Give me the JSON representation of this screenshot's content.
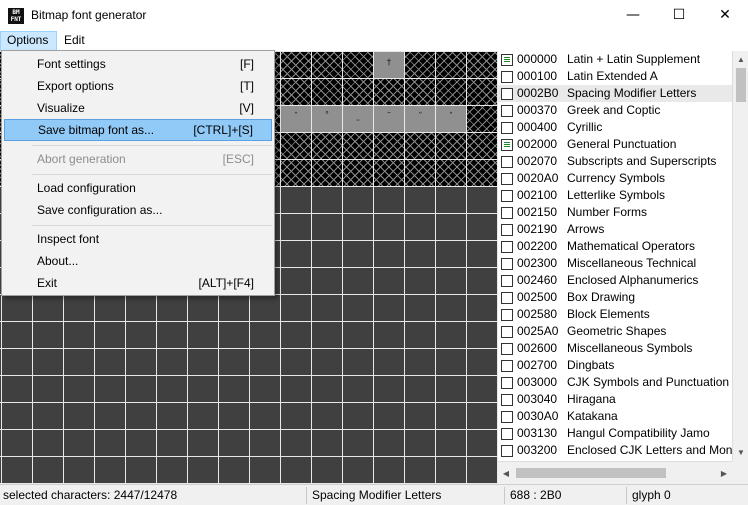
{
  "window": {
    "title": "Bitmap font generator",
    "icon_text": "BM FNT",
    "minimize_glyph": "—",
    "maximize_glyph": "☐",
    "close_glyph": "✕"
  },
  "menubar": {
    "options_label": "Options",
    "edit_label": "Edit"
  },
  "options_menu": {
    "items": [
      {
        "label": "Font settings",
        "shortcut": "[F]"
      },
      {
        "label": "Export options",
        "shortcut": "[T]"
      },
      {
        "label": "Visualize",
        "shortcut": "[V]"
      },
      {
        "label": "Save bitmap font as...",
        "shortcut": "[CTRL]+[S]"
      },
      {
        "label": "Abort generation",
        "shortcut": "[ESC]"
      },
      {
        "label": "Load configuration",
        "shortcut": ""
      },
      {
        "label": "Save configuration as...",
        "shortcut": ""
      },
      {
        "label": "Inspect font",
        "shortcut": ""
      },
      {
        "label": "About...",
        "shortcut": ""
      },
      {
        "label": "Exit",
        "shortcut": "[ALT]+[F4]"
      }
    ]
  },
  "glyphs": [
    "†",
    "ˆ",
    "˚",
    "˷",
    "˜",
    "˝",
    "˟"
  ],
  "charsets": [
    {
      "code": "000000",
      "name": "Latin + Latin Supplement",
      "state": "partial"
    },
    {
      "code": "000100",
      "name": "Latin Extended A",
      "state": "unchecked"
    },
    {
      "code": "0002B0",
      "name": "Spacing Modifier Letters",
      "state": "unchecked"
    },
    {
      "code": "000370",
      "name": "Greek and Coptic",
      "state": "unchecked"
    },
    {
      "code": "000400",
      "name": "Cyrillic",
      "state": "unchecked"
    },
    {
      "code": "002000",
      "name": "General Punctuation",
      "state": "partial"
    },
    {
      "code": "002070",
      "name": "Subscripts and Superscripts",
      "state": "unchecked"
    },
    {
      "code": "0020A0",
      "name": "Currency Symbols",
      "state": "unchecked"
    },
    {
      "code": "002100",
      "name": "Letterlike Symbols",
      "state": "unchecked"
    },
    {
      "code": "002150",
      "name": "Number Forms",
      "state": "unchecked"
    },
    {
      "code": "002190",
      "name": "Arrows",
      "state": "unchecked"
    },
    {
      "code": "002200",
      "name": "Mathematical Operators",
      "state": "unchecked"
    },
    {
      "code": "002300",
      "name": "Miscellaneous Technical",
      "state": "unchecked"
    },
    {
      "code": "002460",
      "name": "Enclosed Alphanumerics",
      "state": "unchecked"
    },
    {
      "code": "002500",
      "name": "Box Drawing",
      "state": "unchecked"
    },
    {
      "code": "002580",
      "name": "Block Elements",
      "state": "unchecked"
    },
    {
      "code": "0025A0",
      "name": "Geometric Shapes",
      "state": "unchecked"
    },
    {
      "code": "002600",
      "name": "Miscellaneous Symbols",
      "state": "unchecked"
    },
    {
      "code": "002700",
      "name": "Dingbats",
      "state": "unchecked"
    },
    {
      "code": "003000",
      "name": "CJK Symbols and Punctuation",
      "state": "unchecked"
    },
    {
      "code": "003040",
      "name": "Hiragana",
      "state": "unchecked"
    },
    {
      "code": "0030A0",
      "name": "Katakana",
      "state": "unchecked"
    },
    {
      "code": "003130",
      "name": "Hangul Compatibility Jamo",
      "state": "unchecked"
    },
    {
      "code": "003200",
      "name": "Enclosed CJK Letters and Months",
      "state": "unchecked"
    }
  ],
  "selected_charset": "Spacing Modifier Letters",
  "status": {
    "selected_characters": "selected characters: 2447/12478",
    "current_block": "Spacing Modifier Letters",
    "position": "688 : 2B0",
    "glyph": "glyph 0"
  },
  "scroll_glyphs": {
    "up": "▲",
    "down": "▼",
    "left": "◀",
    "right": "▶"
  }
}
